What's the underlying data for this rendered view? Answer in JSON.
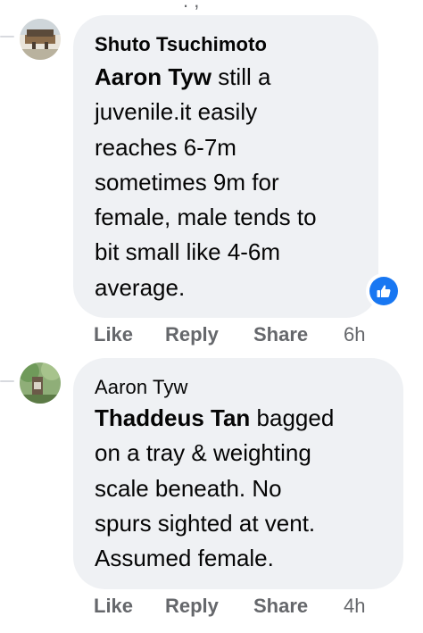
{
  "comments": [
    {
      "author": "Shuto Tsuchimoto",
      "mention": "Aaron Tyw",
      "text_first_line": " still a",
      "text_lines": [
        "juvenile.it easily",
        "reaches 6-7m",
        "sometimes 9m for",
        "female, male tends to",
        "bit small like 4-6m",
        "average."
      ],
      "reaction_icon": "thumbs-up-icon",
      "actions": {
        "like": "Like",
        "reply": "Reply",
        "share": "Share",
        "time": "6h"
      }
    },
    {
      "author": "Aaron Tyw",
      "mention": "Thaddeus Tan",
      "text_first_line": " bagged",
      "text_lines": [
        "on a tray & weighting",
        "scale beneath. No",
        "spurs sighted at vent.",
        "Assumed female."
      ],
      "actions": {
        "like": "Like",
        "reply": "Reply",
        "share": "Share",
        "time": "4h"
      }
    }
  ],
  "colors": {
    "bubble": "#eff1f4",
    "meta_text": "#65676b",
    "like_blue": "#1877f2"
  }
}
